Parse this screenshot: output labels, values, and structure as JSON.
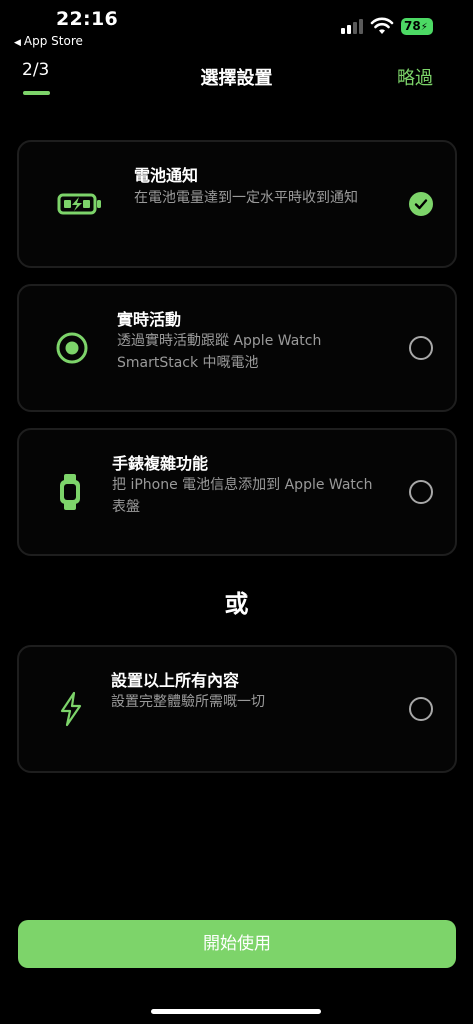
{
  "status_bar": {
    "time": "22:16",
    "back_label": "App Store",
    "battery_level": "78"
  },
  "header": {
    "step": "2/3",
    "title": "選擇設置",
    "skip_label": "略過"
  },
  "options": [
    {
      "icon": "battery-charging-icon",
      "title": "電池通知",
      "description": "在電池電量達到一定水平時收到通知",
      "selected": true
    },
    {
      "icon": "record-circle-icon",
      "title": "實時活動",
      "description_lines": [
        "透過實時活動跟蹤 Apple Watch",
        "SmartStack 中嘅電池"
      ],
      "selected": false
    },
    {
      "icon": "apple-watch-icon",
      "title": "手錶複雜功能",
      "description_lines": [
        "把 iPhone 電池信息添加到 Apple Watch",
        "表盤"
      ],
      "selected": false
    }
  ],
  "divider_text": "或",
  "all_option": {
    "icon": "lightning-icon",
    "title": "設置以上所有內容",
    "description": "設置完整體驗所需嘅一切",
    "selected": false
  },
  "start_button_label": "開始使用",
  "colors": {
    "accent": "#7dd46a",
    "background": "#000000",
    "card_border": "#1e1e1e"
  }
}
